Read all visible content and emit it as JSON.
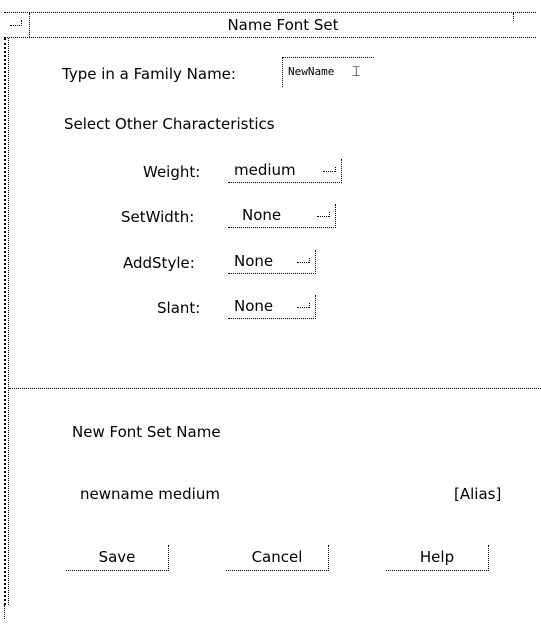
{
  "window": {
    "title": "Name Font Set"
  },
  "family": {
    "label": "Type in a Family Name:",
    "value": "NewName"
  },
  "characteristics": {
    "heading": "Select Other Characteristics",
    "weight": {
      "label": "Weight:",
      "value": "medium"
    },
    "setwidth": {
      "label": "SetWidth:",
      "value": "None"
    },
    "addstyle": {
      "label": "AddStyle:",
      "value": "None"
    },
    "slant": {
      "label": "Slant:",
      "value": "None"
    }
  },
  "result": {
    "heading": "New Font Set Name",
    "name": "newname medium",
    "alias": "[Alias]"
  },
  "buttons": {
    "save": "Save",
    "cancel": "Cancel",
    "help": "Help"
  },
  "icons": {
    "window_menu": "window-menu-icon",
    "option_indicator": "option-menu-indicator-icon",
    "text_cursor": "i-beam-cursor-icon"
  }
}
